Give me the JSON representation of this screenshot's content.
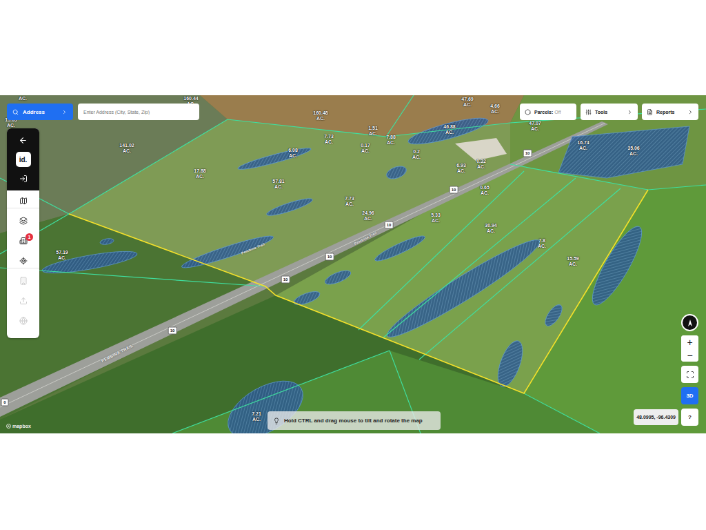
{
  "search": {
    "button": "Address",
    "placeholder": "Enter Address (City, State, Zip)"
  },
  "top_buttons": [
    {
      "label": "Parcels:",
      "state": "Off"
    },
    {
      "label": "Tools"
    },
    {
      "label": "Reports"
    }
  ],
  "sidebar": {
    "logo": "id.",
    "items": [
      {
        "disabled": false
      },
      {
        "disabled": false
      },
      {
        "disabled": false,
        "badge": "1"
      },
      {
        "disabled": false
      },
      {
        "disabled": true
      },
      {
        "disabled": true
      },
      {
        "disabled": true
      }
    ]
  },
  "map": {
    "parcels": [
      {
        "lines": [
          "AC."
        ]
      },
      {
        "lines": [
          "160.44",
          "AC."
        ]
      },
      {
        "lines": [
          "13.63",
          "AC."
        ]
      },
      {
        "lines": [
          "141.02",
          "AC."
        ]
      },
      {
        "lines": [
          "160.48",
          "AC."
        ]
      },
      {
        "lines": [
          "47.69",
          "AC."
        ]
      },
      {
        "lines": [
          "4.66",
          "AC."
        ]
      },
      {
        "lines": [
          "1.51",
          "AC."
        ]
      },
      {
        "lines": [
          "7.88",
          "AC."
        ]
      },
      {
        "lines": [
          "46.88",
          "AC."
        ]
      },
      {
        "lines": [
          "47.07",
          "AC."
        ]
      },
      {
        "lines": [
          "16.74",
          "AC."
        ]
      },
      {
        "lines": [
          "35.06",
          "AC."
        ]
      },
      {
        "lines": [
          "6.08",
          "AC."
        ]
      },
      {
        "lines": [
          "7.73",
          "AC."
        ]
      },
      {
        "lines": [
          "0.17",
          "AC."
        ]
      },
      {
        "lines": [
          "0.2",
          "AC."
        ]
      },
      {
        "lines": [
          "17.88",
          "AC."
        ]
      },
      {
        "lines": [
          "57.81",
          "AC."
        ]
      },
      {
        "lines": [
          "6.93",
          "AC."
        ]
      },
      {
        "lines": [
          "0.32",
          "AC."
        ]
      },
      {
        "lines": [
          "0.65",
          "AC."
        ]
      },
      {
        "lines": [
          "7.73",
          "AC."
        ]
      },
      {
        "lines": [
          "24.96",
          "AC."
        ]
      },
      {
        "lines": [
          "5.33",
          "AC."
        ]
      },
      {
        "lines": [
          "30.94",
          "AC."
        ]
      },
      {
        "lines": [
          "7.8",
          "AC."
        ]
      },
      {
        "lines": [
          "15.59",
          "AC."
        ]
      },
      {
        "lines": [
          "57.19",
          "AC."
        ]
      },
      {
        "lines": [
          "7.21",
          "AC."
        ]
      }
    ],
    "route_shields": [
      "10",
      "10",
      "10",
      "10",
      "10",
      "10",
      "0"
    ],
    "road_names": [
      "PEMBINA TRAIL",
      "Pembina Trail",
      "Pembina Trail"
    ]
  },
  "controls": {
    "zoom_in": "+",
    "zoom_out": "−",
    "mode": {
      "label": "3D",
      "selected": true
    },
    "help": "?"
  },
  "coordinates": "48.0995, -96.4309",
  "hint": "Hold CTRL and drag mouse to tilt and rotate the map",
  "attribution": "mapbox"
}
